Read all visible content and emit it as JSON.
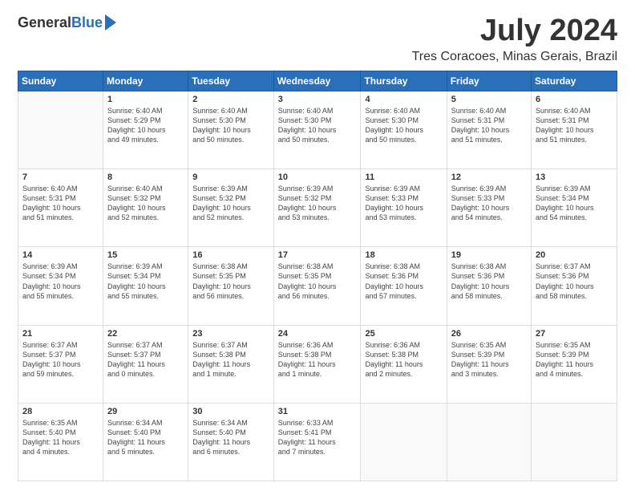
{
  "header": {
    "logo_general": "General",
    "logo_blue": "Blue",
    "title": "July 2024",
    "subtitle": "Tres Coracoes, Minas Gerais, Brazil"
  },
  "calendar": {
    "days": [
      "Sunday",
      "Monday",
      "Tuesday",
      "Wednesday",
      "Thursday",
      "Friday",
      "Saturday"
    ],
    "weeks": [
      [
        {
          "day": "",
          "info": ""
        },
        {
          "day": "1",
          "info": "Sunrise: 6:40 AM\nSunset: 5:29 PM\nDaylight: 10 hours\nand 49 minutes."
        },
        {
          "day": "2",
          "info": "Sunrise: 6:40 AM\nSunset: 5:30 PM\nDaylight: 10 hours\nand 50 minutes."
        },
        {
          "day": "3",
          "info": "Sunrise: 6:40 AM\nSunset: 5:30 PM\nDaylight: 10 hours\nand 50 minutes."
        },
        {
          "day": "4",
          "info": "Sunrise: 6:40 AM\nSunset: 5:30 PM\nDaylight: 10 hours\nand 50 minutes."
        },
        {
          "day": "5",
          "info": "Sunrise: 6:40 AM\nSunset: 5:31 PM\nDaylight: 10 hours\nand 51 minutes."
        },
        {
          "day": "6",
          "info": "Sunrise: 6:40 AM\nSunset: 5:31 PM\nDaylight: 10 hours\nand 51 minutes."
        }
      ],
      [
        {
          "day": "7",
          "info": "Sunrise: 6:40 AM\nSunset: 5:31 PM\nDaylight: 10 hours\nand 51 minutes."
        },
        {
          "day": "8",
          "info": "Sunrise: 6:40 AM\nSunset: 5:32 PM\nDaylight: 10 hours\nand 52 minutes."
        },
        {
          "day": "9",
          "info": "Sunrise: 6:39 AM\nSunset: 5:32 PM\nDaylight: 10 hours\nand 52 minutes."
        },
        {
          "day": "10",
          "info": "Sunrise: 6:39 AM\nSunset: 5:32 PM\nDaylight: 10 hours\nand 53 minutes."
        },
        {
          "day": "11",
          "info": "Sunrise: 6:39 AM\nSunset: 5:33 PM\nDaylight: 10 hours\nand 53 minutes."
        },
        {
          "day": "12",
          "info": "Sunrise: 6:39 AM\nSunset: 5:33 PM\nDaylight: 10 hours\nand 54 minutes."
        },
        {
          "day": "13",
          "info": "Sunrise: 6:39 AM\nSunset: 5:34 PM\nDaylight: 10 hours\nand 54 minutes."
        }
      ],
      [
        {
          "day": "14",
          "info": "Sunrise: 6:39 AM\nSunset: 5:34 PM\nDaylight: 10 hours\nand 55 minutes."
        },
        {
          "day": "15",
          "info": "Sunrise: 6:39 AM\nSunset: 5:34 PM\nDaylight: 10 hours\nand 55 minutes."
        },
        {
          "day": "16",
          "info": "Sunrise: 6:38 AM\nSunset: 5:35 PM\nDaylight: 10 hours\nand 56 minutes."
        },
        {
          "day": "17",
          "info": "Sunrise: 6:38 AM\nSunset: 5:35 PM\nDaylight: 10 hours\nand 56 minutes."
        },
        {
          "day": "18",
          "info": "Sunrise: 6:38 AM\nSunset: 5:36 PM\nDaylight: 10 hours\nand 57 minutes."
        },
        {
          "day": "19",
          "info": "Sunrise: 6:38 AM\nSunset: 5:36 PM\nDaylight: 10 hours\nand 58 minutes."
        },
        {
          "day": "20",
          "info": "Sunrise: 6:37 AM\nSunset: 5:36 PM\nDaylight: 10 hours\nand 58 minutes."
        }
      ],
      [
        {
          "day": "21",
          "info": "Sunrise: 6:37 AM\nSunset: 5:37 PM\nDaylight: 10 hours\nand 59 minutes."
        },
        {
          "day": "22",
          "info": "Sunrise: 6:37 AM\nSunset: 5:37 PM\nDaylight: 11 hours\nand 0 minutes."
        },
        {
          "day": "23",
          "info": "Sunrise: 6:37 AM\nSunset: 5:38 PM\nDaylight: 11 hours\nand 1 minute."
        },
        {
          "day": "24",
          "info": "Sunrise: 6:36 AM\nSunset: 5:38 PM\nDaylight: 11 hours\nand 1 minute."
        },
        {
          "day": "25",
          "info": "Sunrise: 6:36 AM\nSunset: 5:38 PM\nDaylight: 11 hours\nand 2 minutes."
        },
        {
          "day": "26",
          "info": "Sunrise: 6:35 AM\nSunset: 5:39 PM\nDaylight: 11 hours\nand 3 minutes."
        },
        {
          "day": "27",
          "info": "Sunrise: 6:35 AM\nSunset: 5:39 PM\nDaylight: 11 hours\nand 4 minutes."
        }
      ],
      [
        {
          "day": "28",
          "info": "Sunrise: 6:35 AM\nSunset: 5:40 PM\nDaylight: 11 hours\nand 4 minutes."
        },
        {
          "day": "29",
          "info": "Sunrise: 6:34 AM\nSunset: 5:40 PM\nDaylight: 11 hours\nand 5 minutes."
        },
        {
          "day": "30",
          "info": "Sunrise: 6:34 AM\nSunset: 5:40 PM\nDaylight: 11 hours\nand 6 minutes."
        },
        {
          "day": "31",
          "info": "Sunrise: 6:33 AM\nSunset: 5:41 PM\nDaylight: 11 hours\nand 7 minutes."
        },
        {
          "day": "",
          "info": ""
        },
        {
          "day": "",
          "info": ""
        },
        {
          "day": "",
          "info": ""
        }
      ]
    ]
  }
}
